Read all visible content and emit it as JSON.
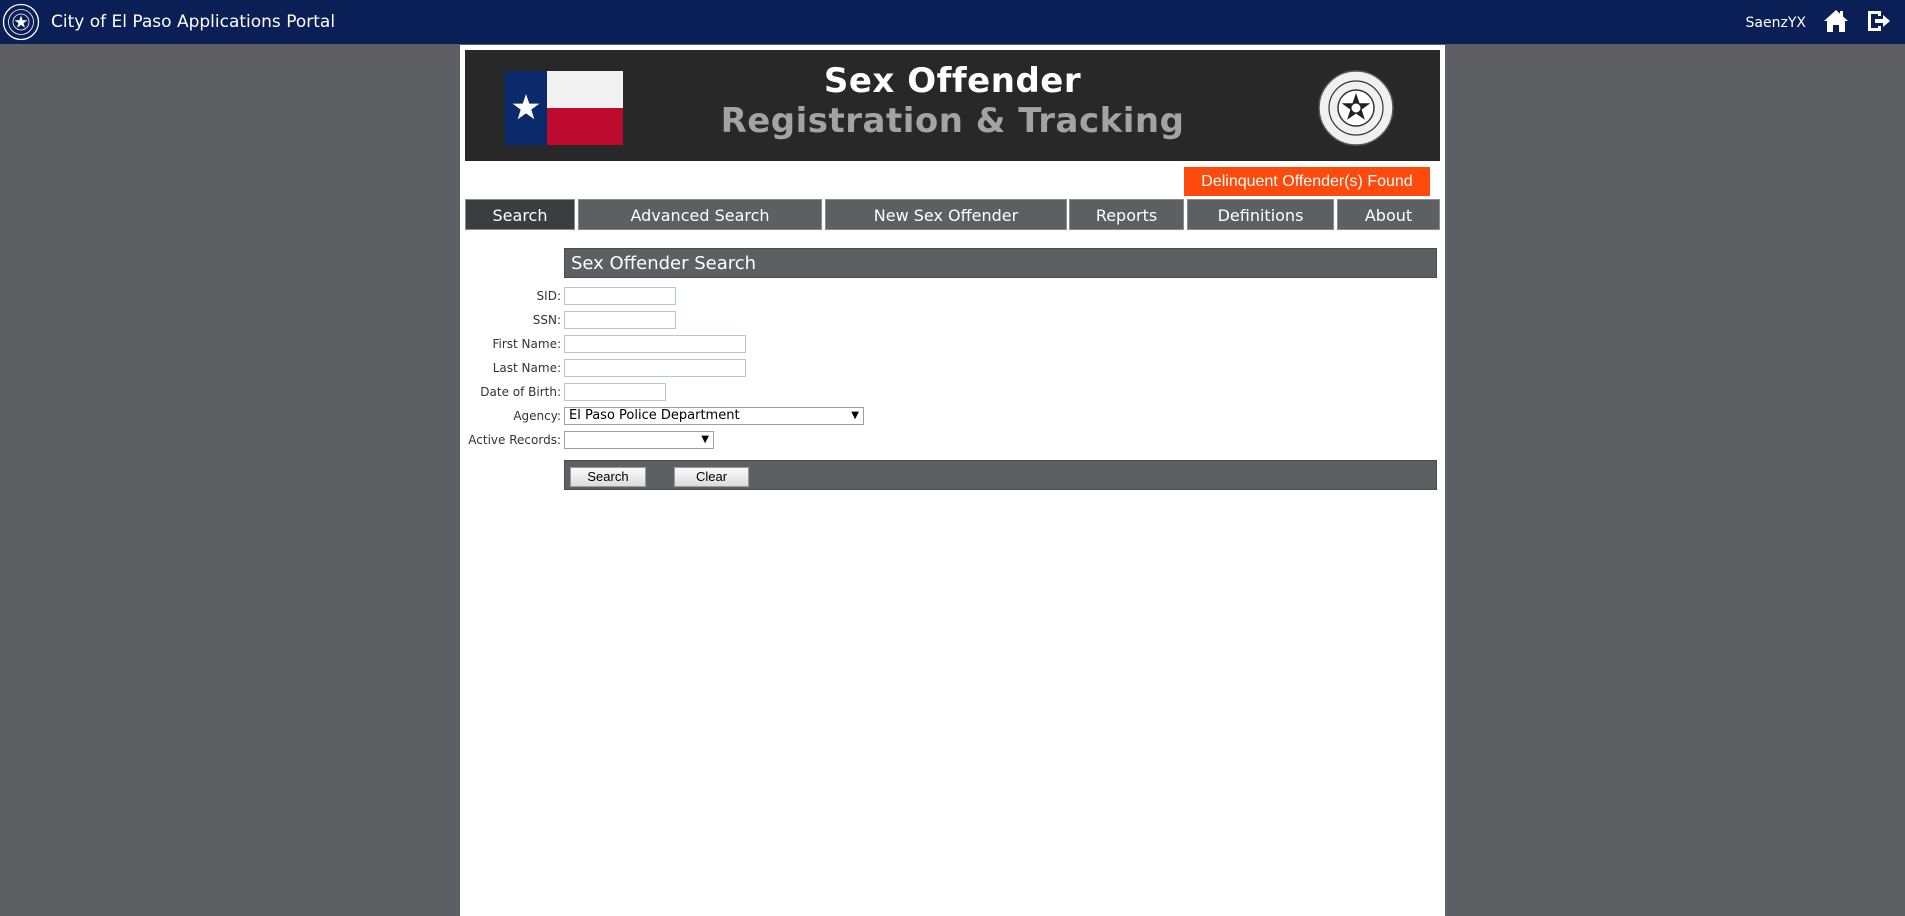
{
  "portal": {
    "title": "City of El Paso Applications Portal",
    "username": "SaenzYX",
    "icons": [
      "home-icon",
      "logout-icon"
    ],
    "bar_color": "#0b1f57"
  },
  "banner": {
    "title_line1": "Sex Offender",
    "title_line2": "Registration & Tracking"
  },
  "alert": {
    "label": "Delinquent Offender(s) Found",
    "color": "#ff4a0d"
  },
  "nav": {
    "tabs": [
      {
        "label": "Search",
        "active": true
      },
      {
        "label": "Advanced Search",
        "active": false
      },
      {
        "label": "New Sex Offender",
        "active": false
      },
      {
        "label": "Reports",
        "active": false
      },
      {
        "label": "Definitions",
        "active": false
      },
      {
        "label": "About",
        "active": false
      }
    ]
  },
  "search": {
    "heading": "Sex Offender Search",
    "fields": {
      "sid": {
        "label": "SID:",
        "value": ""
      },
      "ssn": {
        "label": "SSN:",
        "value": ""
      },
      "first_name": {
        "label": "First Name:",
        "value": ""
      },
      "last_name": {
        "label": "Last Name:",
        "value": ""
      },
      "dob": {
        "label": "Date of Birth:",
        "value": ""
      },
      "agency": {
        "label": "Agency:",
        "value": "El Paso Police Department"
      },
      "active_records": {
        "label": "Active Records:",
        "value": ""
      }
    },
    "buttons": {
      "search": "Search",
      "clear": "Clear"
    }
  }
}
